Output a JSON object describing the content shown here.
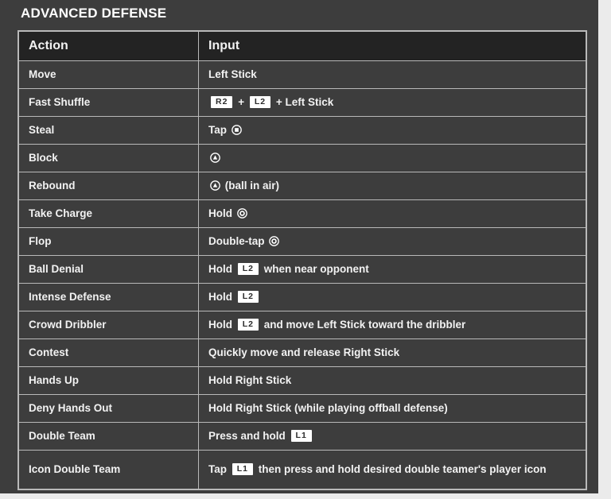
{
  "panel": {
    "title": "ADVANCED DEFENSE",
    "background_color": "#3d3d3d",
    "page_background_color": "#ebebeb",
    "text_color": "#f2f2f2",
    "border_color": "#b9b9b9",
    "header_row_color": "#232323"
  },
  "table": {
    "columns": [
      {
        "key": "action",
        "label": "Action"
      },
      {
        "key": "input",
        "label": "Input"
      }
    ],
    "rows": [
      {
        "action": "Move",
        "input_text": "Left Stick",
        "parts": [
          {
            "type": "text",
            "value": "Left Stick"
          }
        ]
      },
      {
        "action": "Fast Shuffle",
        "input_text": "R2 + L2 + Left Stick",
        "parts": [
          {
            "type": "keycap",
            "value": "R2"
          },
          {
            "type": "text",
            "value": " + "
          },
          {
            "type": "keycap",
            "value": "L2"
          },
          {
            "type": "text",
            "value": " + Left Stick"
          }
        ]
      },
      {
        "action": "Steal",
        "input_text": "Tap Square",
        "parts": [
          {
            "type": "text",
            "value": "Tap "
          },
          {
            "type": "psbutton",
            "value": "square-button-icon"
          }
        ]
      },
      {
        "action": "Block",
        "input_text": "Triangle",
        "parts": [
          {
            "type": "psbutton",
            "value": "triangle-button-icon"
          }
        ]
      },
      {
        "action": "Rebound",
        "input_text": "Triangle (ball in air)",
        "parts": [
          {
            "type": "psbutton",
            "value": "triangle-button-icon"
          },
          {
            "type": "text",
            "value": " (ball in air)"
          }
        ]
      },
      {
        "action": "Take Charge",
        "input_text": "Hold Circle",
        "parts": [
          {
            "type": "text",
            "value": "Hold "
          },
          {
            "type": "psbutton",
            "value": "circle-button-icon"
          }
        ]
      },
      {
        "action": "Flop",
        "input_text": "Double-tap Circle",
        "parts": [
          {
            "type": "text",
            "value": "Double-tap "
          },
          {
            "type": "psbutton",
            "value": "circle-button-icon"
          }
        ]
      },
      {
        "action": "Ball Denial",
        "input_text": "Hold L2 when near opponent",
        "parts": [
          {
            "type": "text",
            "value": "Hold "
          },
          {
            "type": "keycap",
            "value": "L2"
          },
          {
            "type": "text",
            "value": " when near opponent"
          }
        ]
      },
      {
        "action": "Intense Defense",
        "input_text": "Hold L2",
        "parts": [
          {
            "type": "text",
            "value": "Hold "
          },
          {
            "type": "keycap",
            "value": "L2"
          }
        ]
      },
      {
        "action": "Crowd Dribbler",
        "input_text": "Hold L2 and move Left Stick toward the dribbler",
        "parts": [
          {
            "type": "text",
            "value": "Hold "
          },
          {
            "type": "keycap",
            "value": "L2"
          },
          {
            "type": "text",
            "value": " and move Left Stick toward the dribbler"
          }
        ]
      },
      {
        "action": "Contest",
        "input_text": "Quickly move and release Right Stick",
        "parts": [
          {
            "type": "text",
            "value": "Quickly move and release Right Stick"
          }
        ]
      },
      {
        "action": "Hands Up",
        "input_text": "Hold Right Stick",
        "parts": [
          {
            "type": "text",
            "value": "Hold Right Stick"
          }
        ]
      },
      {
        "action": "Deny Hands Out",
        "input_text": "Hold Right Stick (while playing offball defense)",
        "parts": [
          {
            "type": "text",
            "value": "Hold Right Stick (while playing offball defense)"
          }
        ]
      },
      {
        "action": "Double Team",
        "input_text": "Press and hold L1",
        "parts": [
          {
            "type": "text",
            "value": "Press and hold "
          },
          {
            "type": "keycap",
            "value": "L1"
          }
        ]
      },
      {
        "action": "Icon Double Team",
        "input_text": "Tap L1 then press and hold desired double teamer's player icon",
        "tall": true,
        "parts": [
          {
            "type": "text",
            "value": "Tap "
          },
          {
            "type": "keycap",
            "value": "L1"
          },
          {
            "type": "wraptext",
            "value": " then press and hold desired double teamer's player icon"
          }
        ]
      }
    ]
  }
}
